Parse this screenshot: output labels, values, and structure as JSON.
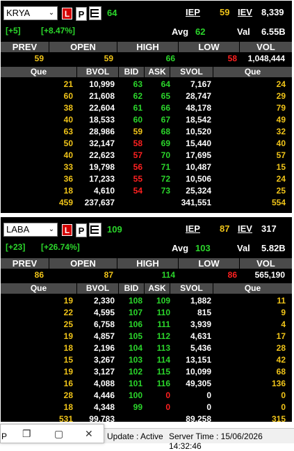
{
  "panels": [
    {
      "symbol": "KRYA",
      "buttons": {
        "l": "L",
        "p": "P"
      },
      "last": "64",
      "change": "[+5]",
      "change_pct": "[+8.47%]",
      "iep_label": "IEP",
      "iep": "59",
      "iev_label": "IEV",
      "iev": "8,339",
      "avg_label": "Avg",
      "avg": "62",
      "val_label": "Val",
      "val": "6.55B",
      "summary_headers": [
        "PREV",
        "OPEN",
        "HIGH",
        "LOW",
        "VOL"
      ],
      "summary_values": [
        "59",
        "59",
        "66",
        "58",
        "1,048,444"
      ],
      "table_headers": [
        "Que",
        "BVOL",
        "BID",
        "ASK",
        "SVOL",
        "Que"
      ],
      "rows": [
        {
          "que_b": "21",
          "bvol": "10,999",
          "bid": "63",
          "ask": "64",
          "svol": "7,167",
          "que_s": "24",
          "bid_c": "green",
          "ask_c": "green"
        },
        {
          "que_b": "60",
          "bvol": "21,608",
          "bid": "62",
          "ask": "65",
          "svol": "28,747",
          "que_s": "29",
          "bid_c": "green",
          "ask_c": "green"
        },
        {
          "que_b": "38",
          "bvol": "22,604",
          "bid": "61",
          "ask": "66",
          "svol": "48,178",
          "que_s": "79",
          "bid_c": "green",
          "ask_c": "green"
        },
        {
          "que_b": "40",
          "bvol": "18,533",
          "bid": "60",
          "ask": "67",
          "svol": "18,542",
          "que_s": "49",
          "bid_c": "green",
          "ask_c": "green"
        },
        {
          "que_b": "63",
          "bvol": "28,986",
          "bid": "59",
          "ask": "68",
          "svol": "10,520",
          "que_s": "32",
          "bid_c": "yellow",
          "ask_c": "green"
        },
        {
          "que_b": "50",
          "bvol": "32,147",
          "bid": "58",
          "ask": "69",
          "svol": "15,440",
          "que_s": "40",
          "bid_c": "red",
          "ask_c": "green"
        },
        {
          "que_b": "40",
          "bvol": "22,623",
          "bid": "57",
          "ask": "70",
          "svol": "17,695",
          "que_s": "57",
          "bid_c": "red",
          "ask_c": "green"
        },
        {
          "que_b": "33",
          "bvol": "19,798",
          "bid": "56",
          "ask": "71",
          "svol": "10,487",
          "que_s": "15",
          "bid_c": "red",
          "ask_c": "green"
        },
        {
          "que_b": "36",
          "bvol": "17,233",
          "bid": "55",
          "ask": "72",
          "svol": "10,506",
          "que_s": "24",
          "bid_c": "red",
          "ask_c": "green"
        },
        {
          "que_b": "18",
          "bvol": "4,610",
          "bid": "54",
          "ask": "73",
          "svol": "25,324",
          "que_s": "25",
          "bid_c": "red",
          "ask_c": "green"
        }
      ],
      "totals": {
        "que_b": "459",
        "bvol": "237,637",
        "svol": "341,551",
        "que_s": "554"
      }
    },
    {
      "symbol": "LABA",
      "buttons": {
        "l": "L",
        "p": "P"
      },
      "last": "109",
      "change": "[+23]",
      "change_pct": "[+26.74%]",
      "iep_label": "IEP",
      "iep": "87",
      "iev_label": "IEV",
      "iev": "317",
      "avg_label": "Avg",
      "avg": "103",
      "val_label": "Val",
      "val": "5.82B",
      "summary_headers": [
        "PREV",
        "OPEN",
        "HIGH",
        "LOW",
        "VOL"
      ],
      "summary_values": [
        "86",
        "87",
        "114",
        "86",
        "565,190"
      ],
      "table_headers": [
        "Que",
        "BVOL",
        "BID",
        "ASK",
        "SVOL",
        "Que"
      ],
      "rows": [
        {
          "que_b": "19",
          "bvol": "2,330",
          "bid": "108",
          "ask": "109",
          "svol": "1,882",
          "que_s": "11",
          "bid_c": "green",
          "ask_c": "green"
        },
        {
          "que_b": "22",
          "bvol": "4,595",
          "bid": "107",
          "ask": "110",
          "svol": "815",
          "que_s": "9",
          "bid_c": "green",
          "ask_c": "green"
        },
        {
          "que_b": "25",
          "bvol": "6,758",
          "bid": "106",
          "ask": "111",
          "svol": "3,939",
          "que_s": "4",
          "bid_c": "green",
          "ask_c": "green"
        },
        {
          "que_b": "19",
          "bvol": "4,857",
          "bid": "105",
          "ask": "112",
          "svol": "4,631",
          "que_s": "17",
          "bid_c": "green",
          "ask_c": "green"
        },
        {
          "que_b": "18",
          "bvol": "2,196",
          "bid": "104",
          "ask": "113",
          "svol": "5,436",
          "que_s": "28",
          "bid_c": "green",
          "ask_c": "green"
        },
        {
          "que_b": "15",
          "bvol": "3,267",
          "bid": "103",
          "ask": "114",
          "svol": "13,151",
          "que_s": "42",
          "bid_c": "green",
          "ask_c": "green"
        },
        {
          "que_b": "19",
          "bvol": "3,127",
          "bid": "102",
          "ask": "115",
          "svol": "10,099",
          "que_s": "68",
          "bid_c": "green",
          "ask_c": "green"
        },
        {
          "que_b": "16",
          "bvol": "4,088",
          "bid": "101",
          "ask": "116",
          "svol": "49,305",
          "que_s": "136",
          "bid_c": "green",
          "ask_c": "green"
        },
        {
          "que_b": "28",
          "bvol": "4,446",
          "bid": "100",
          "ask": "0",
          "svol": "0",
          "que_s": "0",
          "bid_c": "green",
          "ask_c": "red"
        },
        {
          "que_b": "18",
          "bvol": "4,348",
          "bid": "99",
          "ask": "0",
          "svol": "0",
          "que_s": "0",
          "bid_c": "green",
          "ask_c": "red"
        }
      ],
      "totals": {
        "que_b": "531",
        "bvol": "99,783",
        "svol": "89,258",
        "que_s": "315"
      }
    }
  ],
  "status": {
    "prefix": "P",
    "update": "Update : Active",
    "server_time": "Server Time : 15/06/2026 14:32:46"
  },
  "window_controls": {
    "restore": "❐",
    "minimize": "▢",
    "close": "✕"
  },
  "colors": {
    "green": "#2bd62b",
    "yellow": "#f0c419",
    "red": "#ff2020",
    "header_bg": "#4a4a4a"
  }
}
